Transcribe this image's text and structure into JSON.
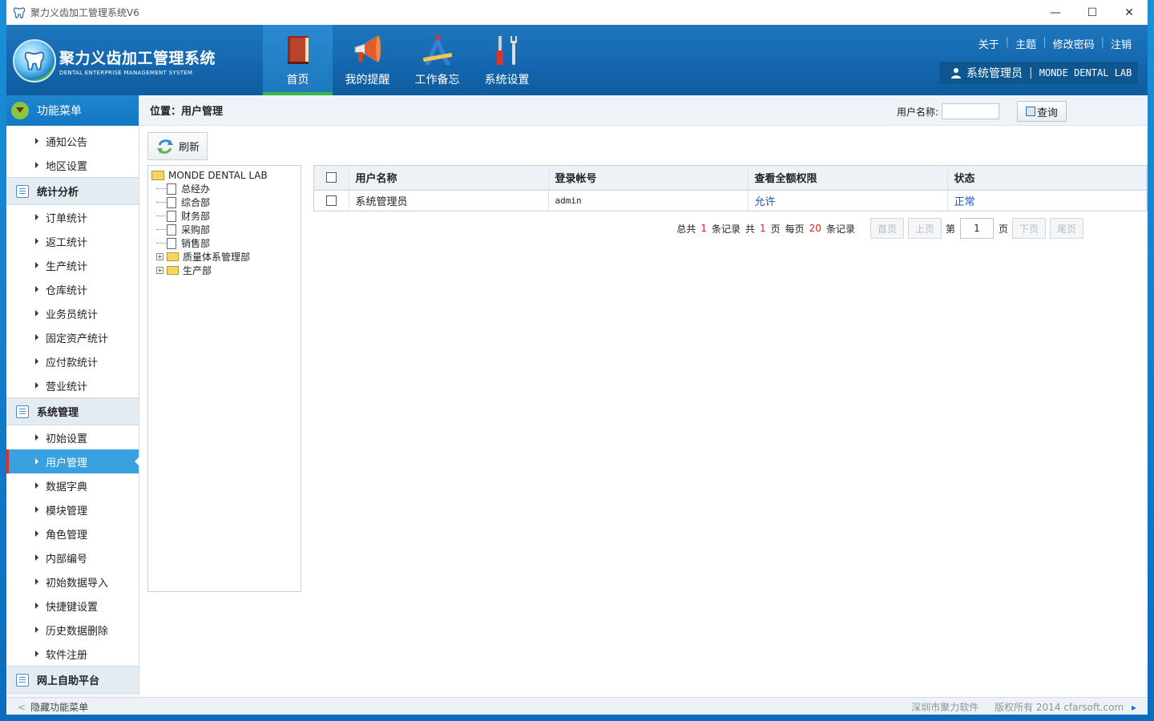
{
  "window": {
    "title": "聚力义齿加工管理系统V6",
    "controls": {
      "minimize": "—",
      "maximize": "☐",
      "close": "✕"
    }
  },
  "header": {
    "logo_cn": "聚力义齿加工管理系统",
    "logo_en": "DENTAL ENTERPRISE MANAGEMENT SYSTEM",
    "nav": [
      {
        "label": "首页",
        "icon": "book-icon",
        "active": true
      },
      {
        "label": "我的提醒",
        "icon": "megaphone-icon",
        "active": false
      },
      {
        "label": "工作备忘",
        "icon": "drafting-tools-icon",
        "active": false
      },
      {
        "label": "系统设置",
        "icon": "tools-icon",
        "active": false
      }
    ],
    "top_links": [
      "关于",
      "主题",
      "修改密码",
      "注销"
    ],
    "user_name": "系统管理员",
    "org_name": "MONDE DENTAL LAB"
  },
  "sidebar": {
    "title": "功能菜单",
    "items_top": [
      "通知公告",
      "地区设置"
    ],
    "group_stats": {
      "title": "统计分析",
      "items": [
        "订单统计",
        "返工统计",
        "生产统计",
        "仓库统计",
        "业务员统计",
        "固定资产统计",
        "应付款统计",
        "营业统计"
      ]
    },
    "group_system": {
      "title": "系统管理",
      "items": [
        "初始设置",
        "用户管理",
        "数据字典",
        "模块管理",
        "角色管理",
        "内部编号",
        "初始数据导入",
        "快捷键设置",
        "历史数据删除",
        "软件注册"
      ],
      "active": "用户管理"
    },
    "group_online": {
      "title": "网上自助平台"
    }
  },
  "main": {
    "location": "位置：用户管理",
    "search_label": "用户名称:",
    "search_button": "查询",
    "refresh_button": "刷新",
    "tree": {
      "root": "MONDE DENTAL LAB",
      "children": [
        {
          "label": "总经办",
          "type": "doc"
        },
        {
          "label": "综合部",
          "type": "doc"
        },
        {
          "label": "财务部",
          "type": "doc"
        },
        {
          "label": "采购部",
          "type": "doc"
        },
        {
          "label": "销售部",
          "type": "doc"
        },
        {
          "label": "质量体系管理部",
          "type": "folder"
        },
        {
          "label": "生产部",
          "type": "folder"
        }
      ]
    },
    "grid": {
      "columns": [
        "用户名称",
        "登录帐号",
        "查看全额权限",
        "状态"
      ],
      "rows": [
        {
          "name": "系统管理员",
          "account": "admin",
          "permission": "允许",
          "status": "正常"
        }
      ]
    },
    "pager": {
      "total_prefix": "总共",
      "total": "1",
      "records_label": "条记录",
      "pages_prefix": "共",
      "pages": "1",
      "page_label": "页",
      "per_page_prefix": "每页",
      "per_page": "20",
      "first": "首页",
      "prev": "上页",
      "current_prefix": "第",
      "current": "1",
      "next": "下页",
      "last": "尾页"
    }
  },
  "footer": {
    "hide_menu": "隐藏功能菜单",
    "company": "深圳市聚力软件",
    "copyright": "版权所有 2014 cfarsoft.com"
  },
  "colors": {
    "header_blue": "#1366ad",
    "active_menu": "#3aa1e0",
    "link_blue": "#1a56c9",
    "accent_green": "#3db54a",
    "pager_red": "#d42020"
  }
}
